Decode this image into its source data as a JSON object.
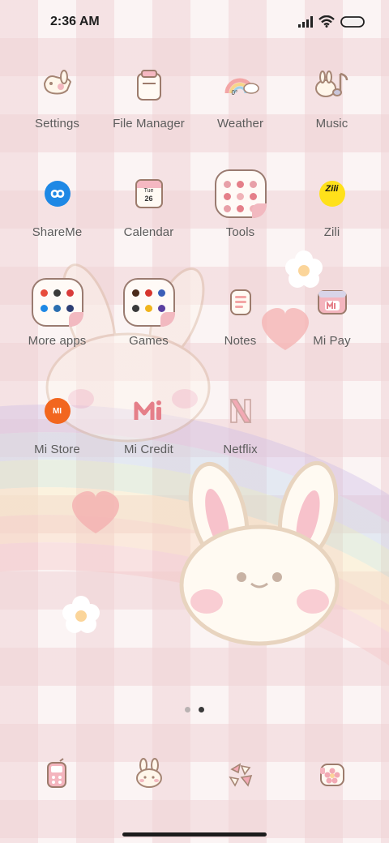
{
  "status_bar": {
    "time": "2:36 AM",
    "icons": [
      "signal-icon",
      "wifi-icon",
      "battery-icon"
    ]
  },
  "apps": [
    {
      "label": "Settings",
      "icon": "bunny-settings-icon"
    },
    {
      "label": "File Manager",
      "icon": "folder-bag-icon"
    },
    {
      "label": "Weather",
      "icon": "rainbow-cloud-icon",
      "badge": "0°"
    },
    {
      "label": "Music",
      "icon": "bunny-music-note-icon"
    },
    {
      "label": "ShareMe",
      "icon": "shareme-infinity-icon"
    },
    {
      "label": "Calendar",
      "icon": "calendar-icon",
      "day_label": "Tue",
      "day_number": "26"
    },
    {
      "label": "Tools",
      "icon": "tools-folder-icon"
    },
    {
      "label": "Zili",
      "icon": "zili-icon",
      "icon_text": "Zili"
    },
    {
      "label": "More apps",
      "icon": "more-apps-folder-icon"
    },
    {
      "label": "Games",
      "icon": "games-folder-icon"
    },
    {
      "label": "Notes",
      "icon": "notes-icon"
    },
    {
      "label": "Mi Pay",
      "icon": "mi-pay-wallet-icon"
    },
    {
      "label": "Mi Store",
      "icon": "mi-store-icon",
      "icon_text": "MI"
    },
    {
      "label": "Mi Credit",
      "icon": "mi-credit-icon"
    },
    {
      "label": "Netflix",
      "icon": "netflix-icon"
    }
  ],
  "dock": [
    {
      "name": "phone-dock-icon",
      "icon": "pink-phone-icon"
    },
    {
      "name": "messages-dock-icon",
      "icon": "bunny-chat-icon"
    },
    {
      "name": "browser-dock-icon",
      "icon": "broken-heart-shards-icon"
    },
    {
      "name": "camera-dock-icon",
      "icon": "flower-camera-icon"
    }
  ],
  "page_indicator": {
    "pages": 2,
    "active": 2
  },
  "colors": {
    "label": "#5c5c5c",
    "check_pink": "#f0d4d6",
    "accent_pink": "#f2a9b4",
    "mi_orange": "#f2661f",
    "shareme_blue": "#1e88e5",
    "zili_yellow": "#ffe11a"
  }
}
